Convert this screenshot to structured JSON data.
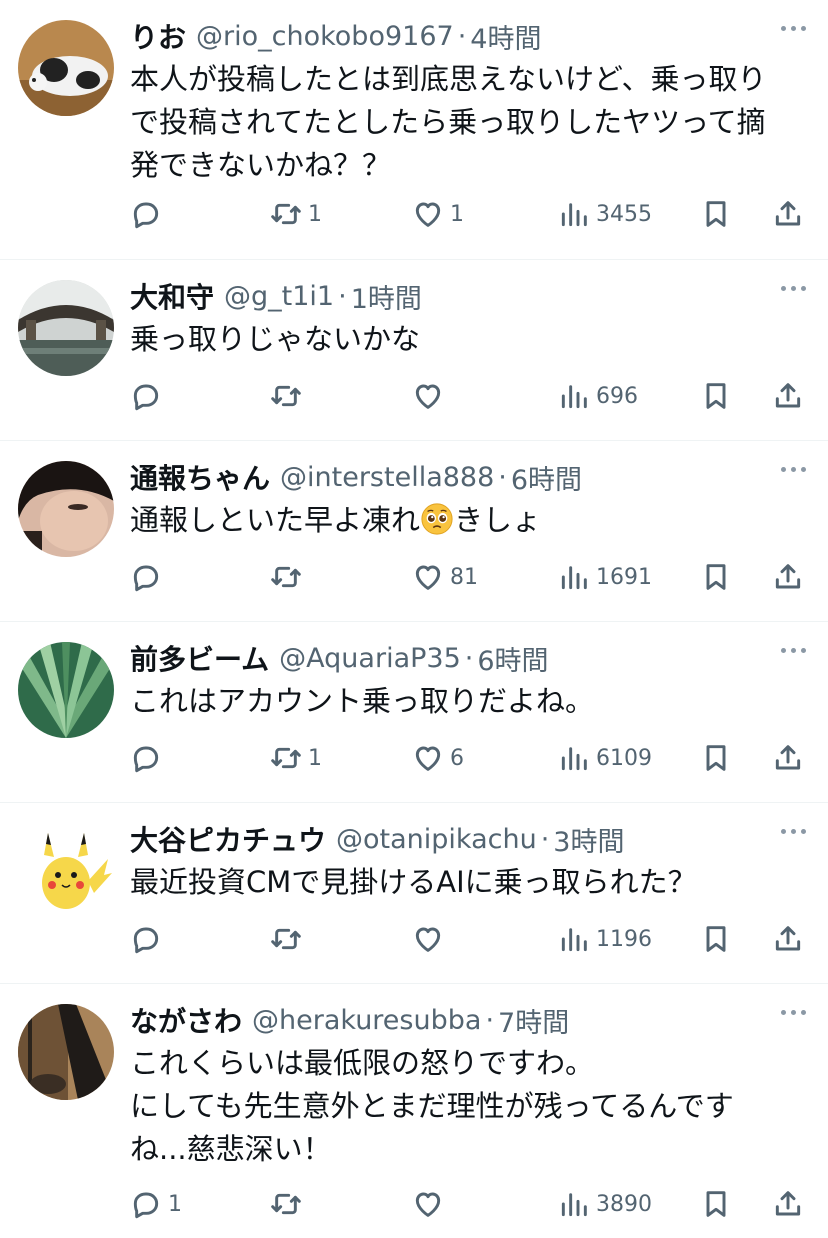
{
  "tweets": [
    {
      "name": "りお",
      "handle": "@rio_chokobo9167",
      "sep": "·",
      "time": "4時間",
      "text": "本人が投稿したとは到底思えないけど、乗っ取り\nで投稿されてたとしたら乗っ取りしたヤツって摘\n発できないかね？？",
      "replies": "",
      "retweets": "1",
      "likes": "1",
      "views": "3455"
    },
    {
      "name": "大和守",
      "handle": "@g_t1i1",
      "sep": "·",
      "time": "1時間",
      "text": "乗っ取りじゃないかな",
      "replies": "",
      "retweets": "",
      "likes": "",
      "views": "696"
    },
    {
      "name": "通報ちゃん",
      "handle": "@interstella888",
      "sep": "·",
      "time": "6時間",
      "text_before": "通報しといた早よ凍れ",
      "emoji": "pleading-face-emoji",
      "text_after": "きしょ",
      "replies": "",
      "retweets": "",
      "likes": "81",
      "views": "1691"
    },
    {
      "name": "前多ビーム",
      "handle": "@AquariaP35",
      "sep": "·",
      "time": "6時間",
      "text": "これはアカウント乗っ取りだよね。",
      "replies": "",
      "retweets": "1",
      "likes": "6",
      "views": "6109"
    },
    {
      "name": "大谷ピカチュウ",
      "handle": "@otanipikachu",
      "sep": "·",
      "time": "3時間",
      "text": "最近投資CMで見掛けるAIに乗っ取られた？",
      "replies": "",
      "retweets": "",
      "likes": "",
      "views": "1196"
    },
    {
      "name": "ながさわ",
      "handle": "@herakuresubba",
      "sep": "·",
      "time": "7時間",
      "text": "これくらいは最低限の怒りですわ。\nにしても先生意外とまだ理性が残ってるんです\nね...慈悲深い！",
      "replies": "1",
      "retweets": "",
      "likes": "",
      "views": "3890"
    }
  ],
  "icons": [
    "reply-icon",
    "retweet-icon",
    "like-icon",
    "views-icon",
    "bookmark-icon",
    "share-icon",
    "more-icon"
  ],
  "colors": {
    "text": "#0f1419",
    "muted": "#536471",
    "divider": "#eff3f4"
  }
}
